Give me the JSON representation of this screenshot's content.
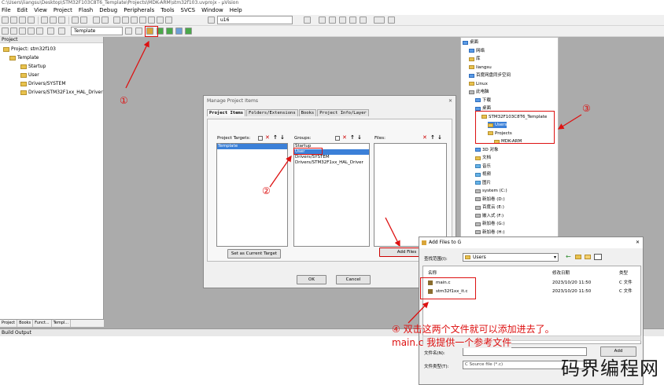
{
  "window": {
    "title": "C:\\Users\\liangsu\\Desktop\\STM32F103C8T6_Template\\Projects\\MDK-ARM\\stm32f103.uvprojx - µVision"
  },
  "menu": [
    "File",
    "Edit",
    "View",
    "Project",
    "Flash",
    "Debug",
    "Peripherals",
    "Tools",
    "SVCS",
    "Window",
    "Help"
  ],
  "toolbar": {
    "target_combo": "Template",
    "search_combo": "u16"
  },
  "project_panel": {
    "title": "Project",
    "root": "Project: stm32f103",
    "target": "Template",
    "groups": [
      "Startup",
      "User",
      "Drivers/SYSTEM",
      "Drivers/STM32F1xx_HAL_Driver"
    ],
    "tabs": [
      "Project",
      "Books",
      "Funct...",
      "Templ..."
    ]
  },
  "build_output": {
    "title": "Build Output"
  },
  "manage_dialog": {
    "title": "Manage Project Items",
    "tabs": [
      "Project Items",
      "Folders/Extensions",
      "Books",
      "Project Info/Layer"
    ],
    "targets_label": "Project Targets:",
    "targets": [
      "Template"
    ],
    "groups_label": "Groups:",
    "groups": [
      "Startup",
      "User",
      "Drivers/SYSTEM",
      "Drivers/STM32F1xx_HAL_Driver"
    ],
    "files_label": "Files:",
    "set_target_btn": "Set as Current Target",
    "add_files_btn": "Add Files",
    "ok_btn": "OK",
    "cancel_btn": "Cancel"
  },
  "folder_tree": {
    "items": [
      {
        "label": "桌面",
        "type": "blue"
      },
      {
        "label": "网络",
        "type": "blue"
      },
      {
        "label": "库",
        "type": "fold"
      },
      {
        "label": "liangsu",
        "type": "fold"
      },
      {
        "label": "百度网盘同步空间",
        "type": "blue"
      },
      {
        "label": "Linux",
        "type": "fold"
      },
      {
        "label": "此电脑",
        "type": "drive"
      },
      {
        "label": "下载",
        "type": "blue"
      },
      {
        "label": "桌面",
        "type": "blue"
      },
      {
        "label": "STM32F103C8T6_Template",
        "type": "fold"
      },
      {
        "label": "Users",
        "type": "fold"
      },
      {
        "label": "Projects",
        "type": "fold"
      },
      {
        "label": "MDK-ARM",
        "type": "fold"
      },
      {
        "label": "3D 对象",
        "type": "blue"
      },
      {
        "label": "文档",
        "type": "fold"
      },
      {
        "label": "音乐",
        "type": "pic"
      },
      {
        "label": "视频",
        "type": "pic"
      },
      {
        "label": "图片",
        "type": "pic"
      },
      {
        "label": "system (C:)",
        "type": "drive"
      },
      {
        "label": "新加卷 (D:)",
        "type": "drive"
      },
      {
        "label": "百度云 (E:)",
        "type": "drive"
      },
      {
        "label": "嵌入式 (F:)",
        "type": "drive"
      },
      {
        "label": "新加卷 (G:)",
        "type": "drive"
      },
      {
        "label": "新加卷 (H:)",
        "type": "drive"
      },
      {
        "label": "新加卷 (I:)",
        "type": "drive"
      },
      {
        "label": "STM32F103C8T6_Template",
        "type": "fold"
      }
    ]
  },
  "add_files_dialog": {
    "title": "Add Files to G",
    "lookin_label": "查找范围(I):",
    "lookin_value": "Users",
    "col_name": "名称",
    "col_date": "修改日期",
    "col_type": "类型",
    "files": [
      {
        "name": "main.c",
        "date": "2023/10/20 11:50",
        "type": "C 文件"
      },
      {
        "name": "stm32f1xx_it.c",
        "date": "2023/10/20 11:50",
        "type": "C 文件"
      }
    ],
    "filename_label": "文件名(N):",
    "filetype_label": "文件类型(T):",
    "filetype_value": "C Source file (*.c)",
    "add_btn": "Add"
  },
  "annotations": {
    "a1": "①",
    "a2": "②",
    "a3": "③",
    "a4_line1": "④ 双击这两个文件就可以添加进去了。",
    "a4_line2_prefix": "main.c",
    "a4_line2_rest": " 我提供一个参考文件"
  },
  "watermark": "码界编程网",
  "colors": {
    "annotation": "#dd1111",
    "selection": "#3b80d8"
  }
}
